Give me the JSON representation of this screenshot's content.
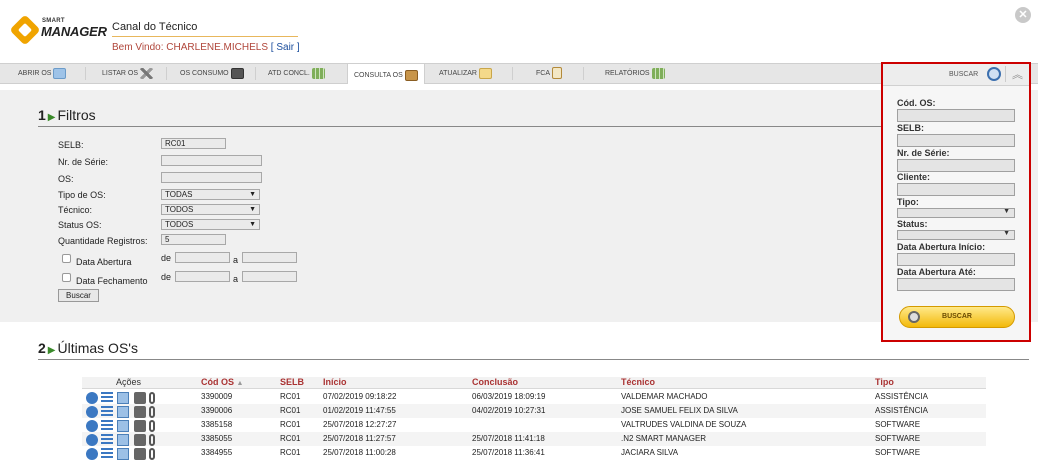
{
  "header": {
    "logo_small": "SMART",
    "logo_big": "MANAGER",
    "title": "Canal do Técnico",
    "welcome_prefix": "Bem Vindo: ",
    "user": "CHARLENE.MICHELS",
    "logout_open": " [ ",
    "logout": "Sair",
    "logout_close": " ]",
    "close_glyph": "✕"
  },
  "tabs": [
    {
      "label": "ABRIR OS",
      "icon": "open-os-icon"
    },
    {
      "label": "LISTAR OS",
      "icon": "tools-icon"
    },
    {
      "label": "OS CONSUMO",
      "icon": "box-icon"
    },
    {
      "label": "ATD CONCL.",
      "icon": "grid-icon"
    },
    {
      "label": "CONSULTA OS",
      "icon": "package-icon"
    },
    {
      "label": "ATUALIZAR",
      "icon": "edit-icon"
    },
    {
      "label": "FCA",
      "icon": "clipboard-icon"
    },
    {
      "label": "RELATÓRIOS",
      "icon": "report-icon"
    }
  ],
  "filters": {
    "section_num": "1",
    "section_title": "Filtros",
    "selb_label": "SELB:",
    "selb_value": "RC01",
    "serie_label": "Nr. de Série:",
    "os_label": "OS:",
    "tipo_label": "Tipo de OS:",
    "tipo_value": "TODAS",
    "tecnico_label": "Técnico:",
    "tecnico_value": "TODOS",
    "status_label": "Status OS:",
    "status_value": "TODOS",
    "qtd_label": "Quantidade Registros:",
    "qtd_value": "5",
    "abertura_label": "Data Abertura",
    "fechamento_label": "Data Fechamento",
    "de": "de",
    "a": "a",
    "buscar": "Buscar"
  },
  "list": {
    "section_num": "2",
    "section_title": "Últimas OS's",
    "columns": [
      "Ações",
      "Cód OS",
      "SELB",
      "Início",
      "Conclusão",
      "Técnico",
      "Tipo"
    ],
    "rows": [
      {
        "cod": "3390009",
        "selb": "RC01",
        "inicio": "07/02/2019 09:18:22",
        "conclusao": "06/03/2019 18:09:19",
        "tecnico": "VALDEMAR MACHADO",
        "tipo": "ASSISTÊNCIA"
      },
      {
        "cod": "3390006",
        "selb": "RC01",
        "inicio": "01/02/2019 11:47:55",
        "conclusao": "04/02/2019 10:27:31",
        "tecnico": "JOSE SAMUEL FELIX DA SILVA",
        "tipo": "ASSISTÊNCIA"
      },
      {
        "cod": "3385158",
        "selb": "RC01",
        "inicio": "25/07/2018 12:27:27",
        "conclusao": "",
        "tecnico": "VALTRUDES VALDINA DE SOUZA",
        "tipo": "SOFTWARE"
      },
      {
        "cod": "3385055",
        "selb": "RC01",
        "inicio": "25/07/2018 11:27:57",
        "conclusao": "25/07/2018 11:41:18",
        "tecnico": ".N2 SMART MANAGER",
        "tipo": "SOFTWARE"
      },
      {
        "cod": "3384955",
        "selb": "RC01",
        "inicio": "25/07/2018 11:00:28",
        "conclusao": "25/07/2018 11:36:41",
        "tecnico": "JACIARA SILVA",
        "tipo": "SOFTWARE"
      }
    ]
  },
  "panel": {
    "buscar_label": "BUSCAR",
    "fields": [
      {
        "label": "Cód. OS:",
        "kind": "input"
      },
      {
        "label": "SELB:",
        "kind": "input"
      },
      {
        "label": "Nr. de Série:",
        "kind": "input"
      },
      {
        "label": "Cliente:",
        "kind": "input"
      },
      {
        "label": "Tipo:",
        "kind": "select"
      },
      {
        "label": "Status:",
        "kind": "select"
      },
      {
        "label": "Data Abertura Início:",
        "kind": "input"
      },
      {
        "label": "Data Abertura Até:",
        "kind": "input"
      }
    ],
    "button": "BUSCAR"
  },
  "colors": {
    "accent": "#c00000",
    "link": "#1a4d9c",
    "header_text": "#a33"
  }
}
